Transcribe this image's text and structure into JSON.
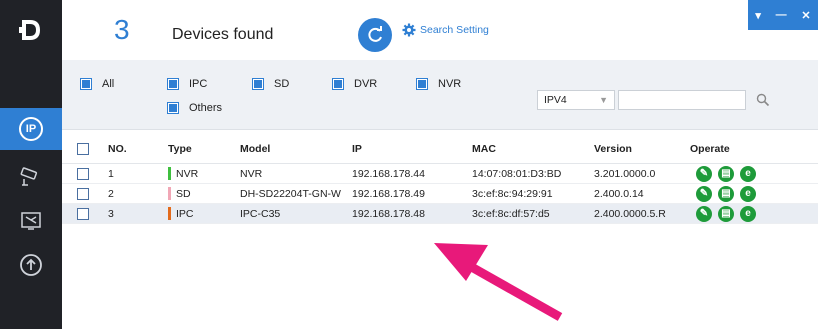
{
  "app": {
    "logo_text": "D"
  },
  "header": {
    "device_count": "3",
    "devices_found_label": "Devices found",
    "search_setting_label": "Search Setting",
    "window_controls": {
      "menu": "▾",
      "minimize": "—",
      "close": "✕"
    }
  },
  "nav": {
    "items": [
      {
        "icon": "ip-search-icon",
        "active": true
      },
      {
        "icon": "camera-icon",
        "active": false
      },
      {
        "icon": "tools-icon",
        "active": false
      },
      {
        "icon": "upgrade-icon",
        "active": false
      }
    ]
  },
  "filters": {
    "all": "All",
    "ipc": "IPC",
    "sd": "SD",
    "dvr": "DVR",
    "nvr": "NVR",
    "others": "Others",
    "ip_version": "IPV4",
    "ip_search_value": ""
  },
  "table": {
    "headers": {
      "no": "NO.",
      "type": "Type",
      "model": "Model",
      "ip": "IP",
      "mac": "MAC",
      "version": "Version",
      "operate": "Operate"
    },
    "rows": [
      {
        "no": "1",
        "type": "NVR",
        "type_color": "#3fbf3f",
        "model": "NVR",
        "ip": "192.168.178.44",
        "mac": "14:07:08:01:D3:BD",
        "version": "3.201.0000.0"
      },
      {
        "no": "2",
        "type": "SD",
        "type_color": "#f1a7b6",
        "model": "DH-SD22204T-GN-W",
        "ip": "192.168.178.49",
        "mac": "3c:ef:8c:94:29:91",
        "version": "2.400.0.14"
      },
      {
        "no": "3",
        "type": "IPC",
        "type_color": "#e36b1c",
        "model": "IPC-C35",
        "ip": "192.168.178.48",
        "mac": "3c:ef:8c:df:57:d5",
        "version": "2.400.0000.5.R"
      }
    ]
  },
  "colors": {
    "accent": "#2f7fd3",
    "annotation": "#e8197a",
    "operate": "#1e9b3a"
  }
}
